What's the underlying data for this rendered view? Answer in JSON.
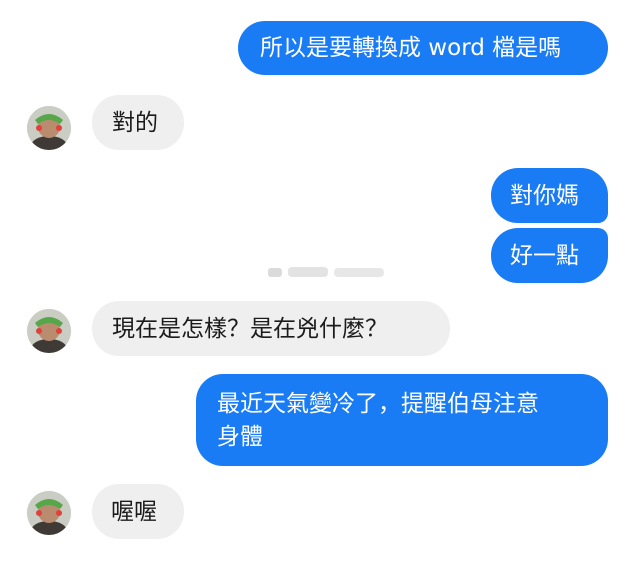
{
  "messages": [
    {
      "from": "me",
      "text": "所以是要轉換成 word 檔是嗎"
    },
    {
      "from": "them",
      "text": "對的"
    },
    {
      "from": "me",
      "text": "對你媽"
    },
    {
      "from": "me",
      "text": "好一點"
    },
    {
      "from": "them",
      "text": "現在是怎樣？是在兇什麼？"
    },
    {
      "from": "me",
      "line1": "最近天氣變冷了，提醒伯母注意",
      "line2": "身體"
    },
    {
      "from": "them",
      "text": "喔喔"
    }
  ],
  "colors": {
    "outgoing_bubble": "#1a7cf4",
    "incoming_bubble": "#efefef",
    "outgoing_text": "#ffffff",
    "incoming_text": "#1b1b1b"
  },
  "icons": {
    "avatar": "contact-avatar",
    "watermark": "blurred-watermark"
  }
}
